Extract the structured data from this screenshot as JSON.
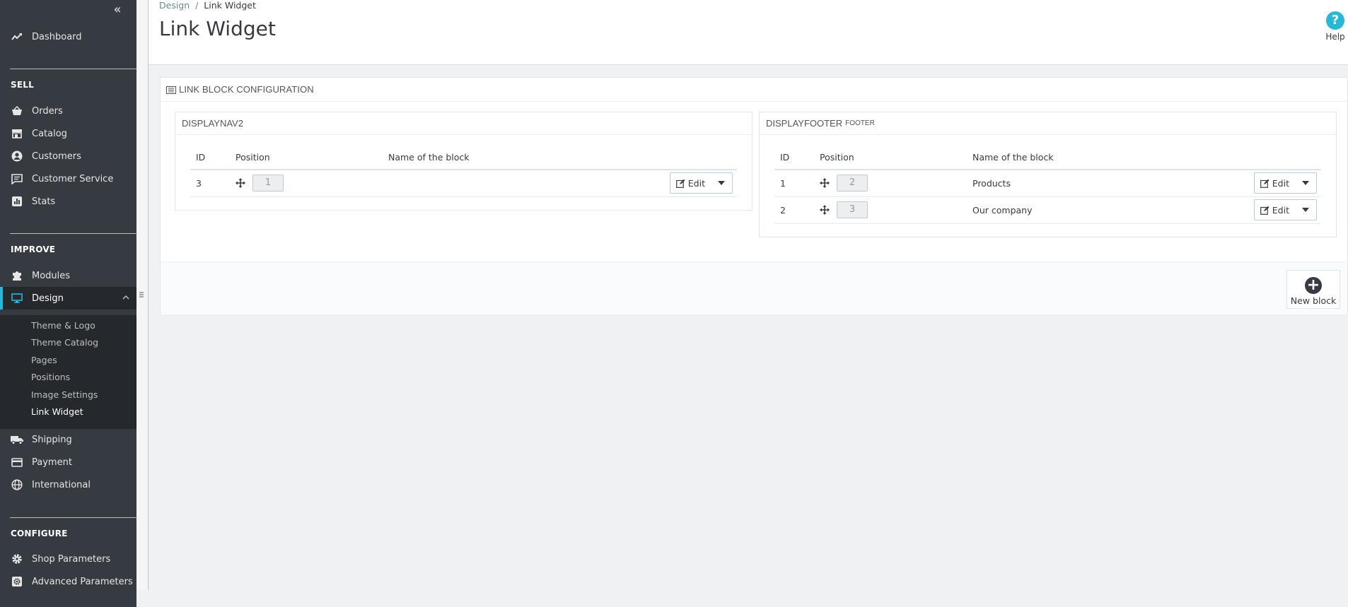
{
  "sidebar": {
    "collapse_glyph": "«",
    "dashboard": "Dashboard",
    "sections": {
      "sell": "SELL",
      "improve": "IMPROVE",
      "configure": "CONFIGURE"
    },
    "sell_items": [
      "Orders",
      "Catalog",
      "Customers",
      "Customer Service",
      "Stats"
    ],
    "improve_items": [
      "Modules",
      "Design"
    ],
    "design_submenu": [
      "Theme & Logo",
      "Theme Catalog",
      "Pages",
      "Positions",
      "Image Settings",
      "Link Widget"
    ],
    "more_items": [
      "Shipping",
      "Payment",
      "International"
    ],
    "configure_items": [
      "Shop Parameters",
      "Advanced Parameters"
    ],
    "active_color": "#25b9d7"
  },
  "header": {
    "breadcrumb": {
      "parent": "Design",
      "sep": "/",
      "current": "Link Widget"
    },
    "title": "Link Widget",
    "help_label": "Help",
    "help_glyph": "?"
  },
  "panel": {
    "heading": "LINK BLOCK CONFIGURATION",
    "blocks": [
      {
        "hook": "DISPLAYNAV2",
        "hook_sub": "",
        "columns": [
          "ID",
          "Position",
          "Name of the block"
        ],
        "rows": [
          {
            "id": "3",
            "position": "1",
            "name": "",
            "action": "Edit"
          }
        ]
      },
      {
        "hook": "DISPLAYFOOTER",
        "hook_sub": "FOOTER",
        "columns": [
          "ID",
          "Position",
          "Name of the block"
        ],
        "rows": [
          {
            "id": "1",
            "position": "2",
            "name": "Products",
            "action": "Edit"
          },
          {
            "id": "2",
            "position": "3",
            "name": "Our company",
            "action": "Edit"
          }
        ]
      }
    ],
    "new_block_label": "New block",
    "new_block_glyph": "+"
  }
}
